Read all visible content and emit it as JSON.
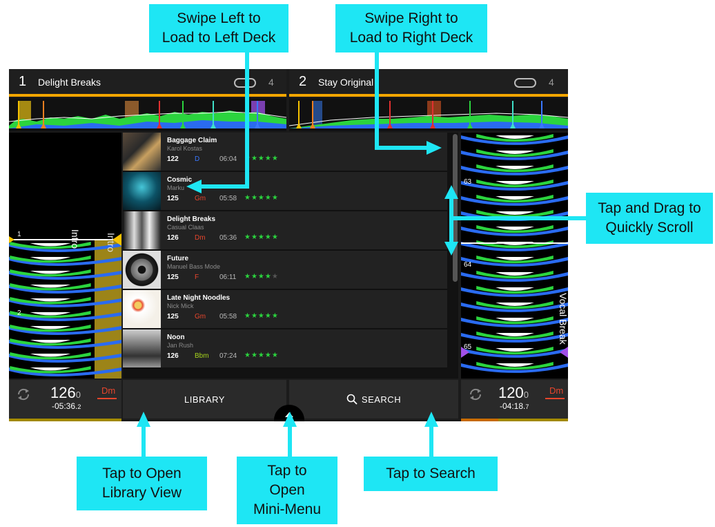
{
  "callouts": {
    "swipe_left": [
      "Swipe Left to",
      "Load to Left Deck"
    ],
    "swipe_right": [
      "Swipe Right to",
      "Load to Right Deck"
    ],
    "scroll": [
      "Tap and Drag to",
      "Quickly Scroll"
    ],
    "library": [
      "Tap to Open",
      "Library View"
    ],
    "mini_menu": [
      "Tap to",
      "Open",
      "Mini-Menu"
    ],
    "search": [
      "Tap to Search"
    ]
  },
  "deck_left": {
    "number": "1",
    "title": "Delight Breaks",
    "loop_count": "4",
    "bpm": "126",
    "bpm_decimal": "0",
    "time_remaining": "-05:36.",
    "time_fraction": "2",
    "key": "Dm",
    "cue_label": "Intro",
    "beat_markers": [
      "1",
      "2"
    ]
  },
  "deck_right": {
    "number": "2",
    "title": "Stay Original",
    "loop_count": "4",
    "bpm": "120",
    "bpm_decimal": "0",
    "time_remaining": "-04:18.",
    "time_fraction": "7",
    "key": "Dm",
    "cue_label": "Vocal Break",
    "beat_markers": [
      "63",
      "64",
      "65"
    ]
  },
  "tracks": [
    {
      "title": "Baggage Claim",
      "artist": "Karol Kostas",
      "bpm": "122",
      "key": "D",
      "key_color": "#3a78ff",
      "length": "06:04",
      "stars": 5
    },
    {
      "title": "Cosmic",
      "artist": "Marku",
      "bpm": "125",
      "key": "Gm",
      "key_color": "#e8452c",
      "length": "05:58",
      "stars": 5
    },
    {
      "title": "Delight Breaks",
      "artist": "Casual Claas",
      "bpm": "126",
      "key": "Dm",
      "key_color": "#e8452c",
      "length": "05:36",
      "stars": 5
    },
    {
      "title": "Future",
      "artist": "Manuel Bass Mode",
      "bpm": "125",
      "key": "F",
      "key_color": "#e8452c",
      "length": "06:11",
      "stars": 4
    },
    {
      "title": "Late Night Noodles",
      "artist": "Nick Mick",
      "bpm": "125",
      "key": "Gm",
      "key_color": "#e8452c",
      "length": "05:58",
      "stars": 5
    },
    {
      "title": "Noon",
      "artist": "Jan Rush",
      "bpm": "126",
      "key": "Bbm",
      "key_color": "#a6d41c",
      "length": "07:24",
      "stars": 5
    }
  ],
  "bottom": {
    "library_label": "LIBRARY",
    "search_label": "SEARCH"
  },
  "colors": {
    "accent": "#f6a600",
    "callout": "#1ee6f4",
    "stars": "#2bd43e",
    "wave_green": "#2bd43e",
    "wave_blue": "#2a6bf0"
  },
  "icons": [
    "loop-icon",
    "sync-icon",
    "search-icon",
    "chevron-up-icon"
  ]
}
